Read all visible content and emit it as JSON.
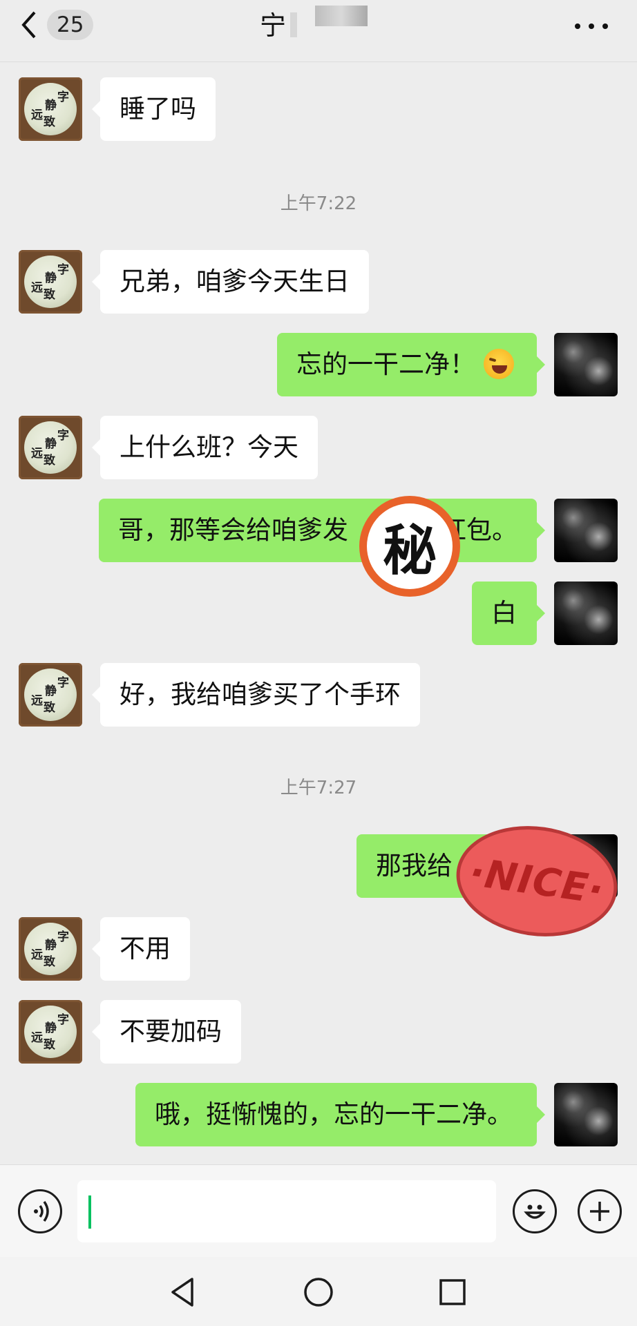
{
  "header": {
    "back_icon": "chevron-left-icon",
    "unread_count": "25",
    "title": "宁",
    "more_icon": "more-dots-icon"
  },
  "messages": [
    {
      "side": "in",
      "text": "睡了吗"
    },
    {
      "type": "time",
      "text": "上午7:22"
    },
    {
      "side": "in",
      "text": "兄弟，咱爹今天生日"
    },
    {
      "side": "out",
      "text": "忘的一干二净！",
      "emoji": "facepalm-laugh-emoji"
    },
    {
      "side": "in",
      "text": "上什么班？今天"
    },
    {
      "side": "out",
      "text": "哥，那等会给咱爹发",
      "text_after": "红包。"
    },
    {
      "side": "out",
      "text": "白"
    },
    {
      "side": "in",
      "text": "好，我给咱爹买了个手环"
    },
    {
      "type": "time",
      "text": "上午7:27"
    },
    {
      "side": "out",
      "text": "那我给"
    },
    {
      "side": "in",
      "text": "不用"
    },
    {
      "side": "in",
      "text": "不要加码"
    },
    {
      "side": "out",
      "text": "哦，挺惭愧的，忘的一干二净。"
    }
  ],
  "stickers": {
    "secret": "秘",
    "nice": "·NICE·"
  },
  "avatars": {
    "contact_text": [
      "静",
      "字",
      "远",
      "致"
    ],
    "contact_icon": "calligraphy-avatar-icon",
    "self_icon": "dark-night-avatar-icon"
  },
  "input_bar": {
    "voice_icon": "voice-icon",
    "input_value": "",
    "emoji_icon": "smiley-icon",
    "plus_icon": "plus-icon"
  },
  "colors": {
    "background": "#ededed",
    "incoming_bubble": "#ffffff",
    "outgoing_bubble": "#95ec69",
    "timestamp": "#8a8a8a",
    "caret": "#07c160"
  }
}
